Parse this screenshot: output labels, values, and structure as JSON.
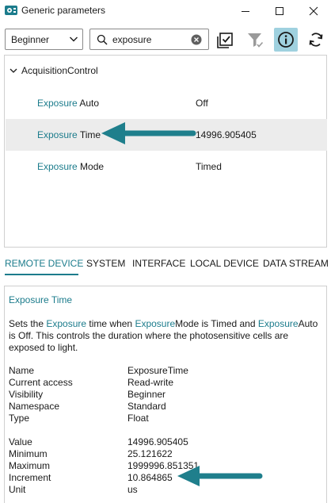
{
  "window": {
    "title": "Generic parameters",
    "controls": [
      "minimize",
      "maximize",
      "close"
    ]
  },
  "toolbar": {
    "visibility_dropdown": {
      "selected": "Beginner"
    },
    "search": {
      "value": "exposure",
      "placeholder": ""
    },
    "buttons": [
      {
        "icon": "checklist-icon",
        "active": false
      },
      {
        "icon": "filter-icon",
        "active": false,
        "disabled": true
      },
      {
        "icon": "info-icon",
        "active": true
      },
      {
        "icon": "refresh-icon",
        "active": false
      }
    ]
  },
  "tree": {
    "group": "AcquisitionControl",
    "rows": [
      {
        "name_highlight": "Exposure",
        "name_rest": " Auto",
        "value": "Off",
        "selected": false
      },
      {
        "name_highlight": "Exposure",
        "name_rest": " Time",
        "value": "14996.905405",
        "selected": true
      },
      {
        "name_highlight": "Exposure",
        "name_rest": " Mode",
        "value": "Timed",
        "selected": false
      }
    ]
  },
  "tabs": [
    {
      "label": "REMOTE DEVICE",
      "active": true
    },
    {
      "label": "SYSTEM",
      "active": false
    },
    {
      "label": "INTERFACE",
      "active": false
    },
    {
      "label": "LOCAL DEVICE",
      "active": false
    },
    {
      "label": "DATA STREAM",
      "active": false
    }
  ],
  "info": {
    "title_highlight": "Exposure",
    "title_rest": " Time",
    "description": [
      {
        "text": "Sets the ",
        "hl": false
      },
      {
        "text": "Exposure",
        "hl": true
      },
      {
        "text": " time when ",
        "hl": false
      },
      {
        "text": "Exposure",
        "hl": true
      },
      {
        "text": "Mode is Timed and ",
        "hl": false
      },
      {
        "text": "Exposure",
        "hl": true
      },
      {
        "text": "Auto is Off. This controls the duration where the photosensitive cells are exposed to light.",
        "hl": false
      }
    ],
    "properties_a": [
      {
        "key": "Name",
        "value": "ExposureTime"
      },
      {
        "key": "Current access",
        "value": "Read-write"
      },
      {
        "key": "Visibility",
        "value": "Beginner"
      },
      {
        "key": "Namespace",
        "value": "Standard"
      },
      {
        "key": "Type",
        "value": "Float"
      }
    ],
    "properties_b": [
      {
        "key": "Value",
        "value": "14996.905405"
      },
      {
        "key": "Minimum",
        "value": "25.121622"
      },
      {
        "key": "Maximum",
        "value": "1999996.851351"
      },
      {
        "key": "Increment",
        "value": "10.864865"
      },
      {
        "key": "Unit",
        "value": "us"
      }
    ]
  },
  "colors": {
    "accent": "#1c7c8c",
    "arrow": "#1f7f8c",
    "active_button": "#9fd1df",
    "selected_row": "#ececec"
  }
}
